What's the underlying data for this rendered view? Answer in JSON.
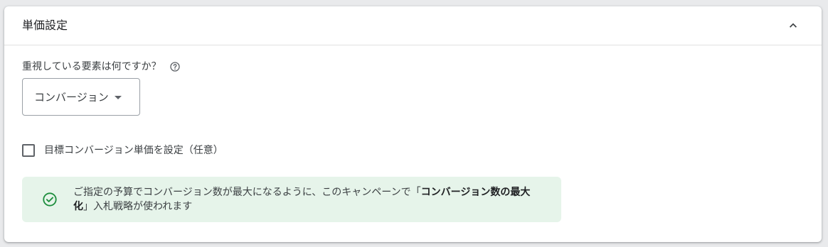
{
  "section": {
    "title": "単価設定",
    "collapse_icon": "chevron-up-icon"
  },
  "question": {
    "label": "重視している要素は何ですか？",
    "help_icon": "help-circle-icon"
  },
  "dropdown": {
    "selected": "コンバージョン",
    "caret_icon": "caret-down-icon"
  },
  "target_cpa": {
    "label": "目標コンバージョン単価を設定（任意）",
    "checked": false
  },
  "info": {
    "icon": "check-circle-icon",
    "text_before": "ご指定の予算でコンバージョン数が最大になるように、このキャンペーンで「",
    "text_bold": "コンバージョン数の最大化",
    "text_after": "」入札戦略が使われます",
    "colors": {
      "background": "#e6f4ea",
      "icon": "#1e8e3e"
    }
  }
}
